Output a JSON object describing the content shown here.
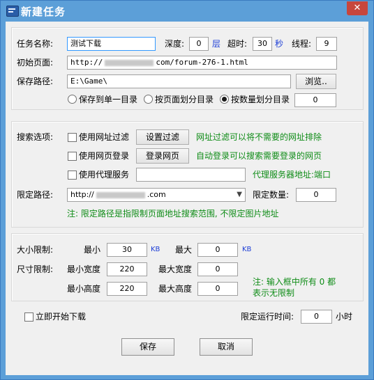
{
  "window": {
    "title": "新建任务",
    "close_glyph": "✕"
  },
  "task": {
    "name_label": "任务名称:",
    "name_value": "测试下载",
    "depth_label": "深度:",
    "depth_value": "0",
    "depth_unit": "层",
    "timeout_label": "超时:",
    "timeout_value": "30",
    "timeout_unit": "秒",
    "threads_label": "线程:",
    "threads_value": "9",
    "start_page_label": "初始页面:",
    "start_page_prefix": "http://",
    "start_page_suffix": "com/forum-276-1.html",
    "save_path_label": "保存路径:",
    "save_path_value": "E:\\Game\\",
    "browse_label": "浏览..",
    "radio_single": "保存到单一目录",
    "radio_by_page": "按页面划分目录",
    "radio_by_count": "按数量划分目录",
    "radio_selected": "by_count",
    "count_value": "0"
  },
  "search": {
    "label": "搜索选项:",
    "url_filter_label": "使用网址过滤",
    "url_filter_button": "设置过滤",
    "url_filter_hint": "网址过滤可以将不需要的网址排除",
    "web_login_label": "使用网页登录",
    "web_login_button": "登录网页",
    "web_login_hint": "自动登录可以搜索需要登录的网页",
    "proxy_label": "使用代理服务",
    "proxy_value": "",
    "proxy_hint": "代理服务器地址:端口",
    "limit_path_label": "限定路径:",
    "limit_path_prefix": "http://",
    "limit_path_suffix": ".com",
    "limit_count_label": "限定数量:",
    "limit_count_value": "0",
    "note": "注: 限定路径是指限制页面地址搜索范围, 不限定图片地址"
  },
  "limits": {
    "size_label": "大小限制:",
    "min_label": "最小",
    "min_value": "30",
    "min_unit": "KB",
    "max_label": "最大",
    "max_value": "0",
    "max_unit": "KB",
    "dim_label": "尺寸限制:",
    "min_width_label": "最小宽度",
    "min_width_value": "220",
    "max_width_label": "最大宽度",
    "max_width_value": "0",
    "min_height_label": "最小高度",
    "min_height_value": "220",
    "max_height_label": "最大高度",
    "max_height_value": "0",
    "note_line1": "注: 输入框中所有 0 都",
    "note_line2": "表示无限制"
  },
  "footer": {
    "start_now_label": "立即开始下载",
    "run_time_label": "限定运行时间:",
    "run_time_value": "0",
    "run_time_unit": "小时",
    "save_button": "保存",
    "cancel_button": "取消"
  },
  "colors": {
    "title_bar": "#5c9fd8",
    "accent_blue": "#1e3fd6",
    "hint_green": "#0f8c17",
    "close_red": "#c7463d"
  }
}
